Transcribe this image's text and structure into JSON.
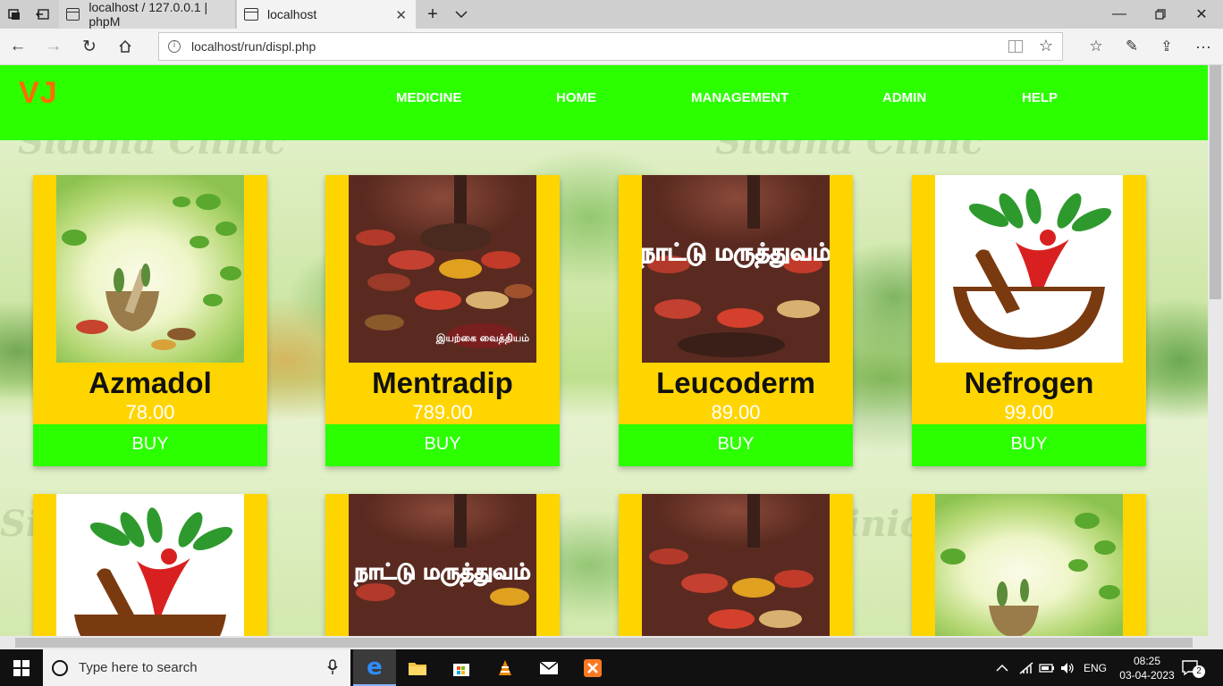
{
  "browser": {
    "tabs": [
      {
        "title": "localhost / 127.0.0.1 | phpM",
        "active": false
      },
      {
        "title": "localhost",
        "active": true
      }
    ],
    "url": "localhost/run/displ.php"
  },
  "site": {
    "logo": "VJ",
    "menu": [
      "MEDICINE",
      "HOME",
      "MANAGEMENT",
      "ADMIN",
      "HELP"
    ]
  },
  "products": [
    {
      "name": "Azmadol",
      "price": "78.00",
      "buy_label": "BUY",
      "image": "herb-mortar"
    },
    {
      "name": "Mentradip",
      "price": "789.00",
      "buy_label": "BUY",
      "image": "spice-bowls",
      "overlay_tamil": "இயற்கை வைத்தியம்"
    },
    {
      "name": "Leucoderm",
      "price": "89.00",
      "buy_label": "BUY",
      "image": "spice-bowls",
      "overlay_tamil": "நாட்டு மருத்துவம்"
    },
    {
      "name": "Nefrogen",
      "price": "99.00",
      "buy_label": "BUY",
      "image": "herbal-logo"
    },
    {
      "image": "herbal-logo"
    },
    {
      "image": "spice-bowls",
      "overlay_tamil": "நாட்டு மருத்துவம்"
    },
    {
      "image": "spice-bowls"
    },
    {
      "image": "herb-mortar"
    }
  ],
  "taskbar": {
    "search_placeholder": "Type here to search",
    "language": "ENG",
    "time": "08:25",
    "date": "03-04-2023",
    "notification_count": "2"
  },
  "colors": {
    "header_green": "#2cff00",
    "card_yellow": "#ffd500",
    "logo_orange": "#ff6a00"
  }
}
